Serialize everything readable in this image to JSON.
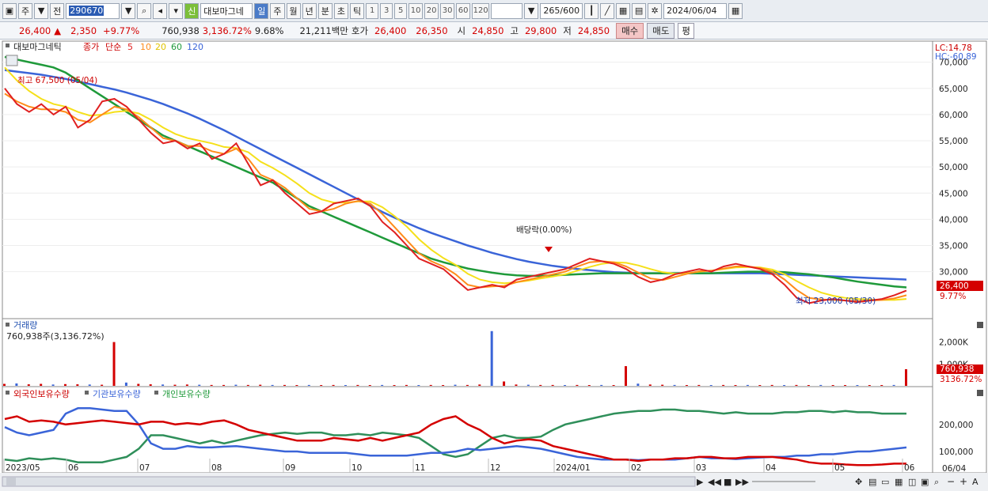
{
  "toolbar": {
    "market": "주",
    "prev_label": "전",
    "code": "290670",
    "new_badge": "신",
    "name": "대보마그네",
    "periods": [
      "일",
      "주",
      "월",
      "년",
      "분",
      "초",
      "틱"
    ],
    "intervals": [
      "1",
      "3",
      "5",
      "10",
      "20",
      "30",
      "60",
      "120"
    ],
    "count": "265/600",
    "date": "2024/06/04"
  },
  "price": {
    "last": "26,400",
    "change": "2,350",
    "change_pct": "+9.77%",
    "volume": "760,938",
    "volume_pct": "3,136.72%",
    "turnover": "9.68%",
    "amount": "21,211백만",
    "ask_label": "호가",
    "ask": "26,400",
    "bid": "26,350",
    "open_label": "시",
    "open": "24,850",
    "high_label": "고",
    "high": "29,800",
    "low_label": "저",
    "low": "24,850",
    "buy_label": "매수",
    "sell_label": "매도",
    "eval_label": "평"
  },
  "chart_data": [
    {
      "type": "line",
      "title": "대보마그네틱",
      "legend": [
        "종가",
        "단순",
        "5",
        "10",
        "20",
        "60",
        "120"
      ],
      "colors": {
        "ma5": "#e02020",
        "ma10": "#ff8c1a",
        "ma20": "#f5e01a",
        "ma60": "#1f9a3a",
        "ma120": "#3a64d8"
      },
      "x_ticks": [
        "2023/05",
        "06",
        "07",
        "08",
        "09",
        "10",
        "11",
        "12",
        "2024/01",
        "02",
        "03",
        "04",
        "05",
        "06"
      ],
      "y_ticks": [
        "70,000",
        "65,000",
        "60,000",
        "55,000",
        "50,000",
        "45,000",
        "40,000",
        "35,000",
        "30,000"
      ],
      "ylim": [
        23000,
        71000
      ],
      "lc": "LC:14.78",
      "hc": "HC:-60.89",
      "annot_high": "최고 67,500 (05/04)",
      "annot_low": "최저 23,000 (05/30)",
      "annot_div": "배당락(0.00%)",
      "last_label": "26,400",
      "last_pct": "9.77%",
      "series": [
        {
          "name": "5",
          "values": [
            65000,
            62000,
            60500,
            62000,
            60000,
            61500,
            57500,
            59000,
            62500,
            63000,
            61500,
            59000,
            56500,
            54500,
            55000,
            53500,
            54500,
            51500,
            52500,
            54500,
            50500,
            46500,
            47500,
            45000,
            43000,
            41000,
            41500,
            43000,
            43500,
            44000,
            42500,
            39500,
            37500,
            35000,
            32500,
            31500,
            30500,
            28500,
            26500,
            27000,
            27500,
            27000,
            28500,
            29000,
            29500,
            30000,
            30500,
            31500,
            32500,
            32000,
            31500,
            30500,
            29000,
            28000,
            28500,
            29500,
            30000,
            30500,
            30000,
            31000,
            31500,
            31000,
            30500,
            29500,
            27500,
            25000,
            24000,
            24500,
            24800,
            24500,
            24200,
            24500,
            24800,
            25500,
            26400
          ]
        },
        {
          "name": "10",
          "values": [
            64000,
            62500,
            61500,
            61000,
            61000,
            60500,
            59000,
            58500,
            60000,
            61500,
            61000,
            59500,
            57500,
            55500,
            55000,
            54000,
            54000,
            53000,
            52500,
            53500,
            51500,
            48500,
            47500,
            46000,
            44000,
            42000,
            41500,
            42000,
            43000,
            43500,
            43000,
            41000,
            38500,
            36000,
            33500,
            32000,
            31000,
            29500,
            27500,
            27000,
            27200,
            27300,
            28000,
            28500,
            29000,
            29500,
            30000,
            31000,
            31800,
            32000,
            31800,
            31000,
            29800,
            28700,
            28400,
            29000,
            29600,
            30100,
            30200,
            30600,
            31000,
            31000,
            30700,
            30000,
            28500,
            26500,
            25000,
            24700,
            24600,
            24500,
            24400,
            24500,
            24600,
            24900,
            25500
          ]
        },
        {
          "name": "20",
          "values": [
            69000,
            66500,
            64500,
            63000,
            62000,
            61500,
            60500,
            59800,
            60000,
            60500,
            60700,
            60200,
            59000,
            57500,
            56300,
            55500,
            55000,
            54500,
            53800,
            53600,
            52800,
            51000,
            49800,
            48400,
            46800,
            45000,
            43800,
            43200,
            43200,
            43400,
            43400,
            42300,
            40600,
            38600,
            36200,
            34200,
            32600,
            31300,
            29600,
            28500,
            28000,
            27800,
            28000,
            28300,
            28700,
            29100,
            29500,
            30200,
            30900,
            31500,
            31800,
            31700,
            31200,
            30500,
            29900,
            29600,
            29700,
            30000,
            30200,
            30500,
            30800,
            30900,
            30800,
            30400,
            29500,
            28200,
            27000,
            26000,
            25400,
            25000,
            24800,
            24700,
            24600,
            24600,
            24800
          ]
        },
        {
          "name": "60",
          "values": [
            71000,
            70500,
            70000,
            69500,
            69000,
            68000,
            66500,
            65000,
            63500,
            62000,
            60500,
            59000,
            57500,
            56000,
            55000,
            54000,
            53000,
            52000,
            51000,
            50000,
            49000,
            48000,
            47000,
            45500,
            44000,
            42500,
            41500,
            40500,
            39500,
            38500,
            37500,
            36500,
            35500,
            34500,
            33500,
            32500,
            31800,
            31200,
            30600,
            30200,
            29800,
            29500,
            29300,
            29200,
            29200,
            29300,
            29400,
            29500,
            29600,
            29700,
            29700,
            29700,
            29700,
            29700,
            29700,
            29700,
            29700,
            29700,
            29700,
            29800,
            29900,
            30000,
            30000,
            30000,
            29900,
            29700,
            29500,
            29200,
            28900,
            28500,
            28100,
            27800,
            27500,
            27200,
            27000
          ]
        },
        {
          "name": "120",
          "values": [
            68500,
            68200,
            67900,
            67600,
            67200,
            66800,
            66300,
            65800,
            65300,
            64800,
            64200,
            63500,
            62800,
            62000,
            61100,
            60200,
            59200,
            58100,
            57000,
            55800,
            54600,
            53400,
            52200,
            51000,
            49800,
            48600,
            47400,
            46200,
            45000,
            43800,
            42600,
            41400,
            40300,
            39300,
            38300,
            37400,
            36600,
            35800,
            35000,
            34300,
            33600,
            33000,
            32400,
            31900,
            31500,
            31100,
            30800,
            30500,
            30300,
            30100,
            29900,
            29800,
            29700,
            29700,
            29700,
            29700,
            29700,
            29700,
            29700,
            29700,
            29700,
            29700,
            29700,
            29600,
            29500,
            29400,
            29300,
            29200,
            29100,
            29000,
            28900,
            28800,
            28700,
            28600,
            28500
          ]
        }
      ]
    },
    {
      "type": "bar",
      "title": "거래량",
      "info": "760,938주(3,136.72%)",
      "y_ticks": [
        "2,000K",
        "1,000K"
      ],
      "ylim": [
        0,
        2600000
      ],
      "last_label": "760,938",
      "last_pct": "3136.72%",
      "values": [
        90000,
        110000,
        70000,
        90000,
        60000,
        80000,
        70000,
        60000,
        50000,
        2000000,
        150000,
        90000,
        70000,
        60000,
        50000,
        60000,
        50000,
        40000,
        40000,
        50000,
        40000,
        50000,
        40000,
        40000,
        35000,
        40000,
        30000,
        40000,
        30000,
        40000,
        30000,
        40000,
        30000,
        40000,
        30000,
        40000,
        30000,
        50000,
        40000,
        60000,
        2500000,
        200000,
        60000,
        50000,
        40000,
        40000,
        30000,
        40000,
        30000,
        40000,
        30000,
        900000,
        100000,
        60000,
        50000,
        40000,
        30000,
        40000,
        30000,
        40000,
        30000,
        40000,
        30000,
        40000,
        30000,
        40000,
        30000,
        40000,
        30000,
        30000,
        30000,
        30000,
        30000,
        40000,
        760938
      ]
    },
    {
      "type": "line",
      "title": "외국인보유수량",
      "legend": [
        "외국인보유수량",
        "기관보유수량",
        "개인보유수량"
      ],
      "y_ticks": [
        "200,000",
        "100,000"
      ],
      "ylim": [
        30000,
        290000
      ],
      "series": [
        {
          "name": "외국인보유수량",
          "values": [
            220000,
            230000,
            210000,
            215000,
            210000,
            200000,
            205000,
            210000,
            215000,
            210000,
            205000,
            200000,
            210000,
            210000,
            200000,
            205000,
            200000,
            210000,
            215000,
            200000,
            180000,
            170000,
            160000,
            150000,
            140000,
            140000,
            140000,
            150000,
            145000,
            140000,
            150000,
            140000,
            150000,
            160000,
            170000,
            200000,
            220000,
            230000,
            200000,
            180000,
            150000,
            130000,
            140000,
            145000,
            140000,
            120000,
            110000,
            100000,
            90000,
            80000,
            70000,
            70000,
            65000,
            70000,
            70000,
            75000,
            75000,
            80000,
            80000,
            75000,
            75000,
            80000,
            80000,
            80000,
            75000,
            70000,
            60000,
            55000,
            55000,
            52000,
            50000,
            50000,
            52000,
            55000,
            55000
          ]
        },
        {
          "name": "기관보유수량",
          "values": [
            190000,
            170000,
            160000,
            170000,
            180000,
            240000,
            260000,
            260000,
            255000,
            250000,
            250000,
            200000,
            130000,
            110000,
            110000,
            120000,
            115000,
            115000,
            118000,
            120000,
            115000,
            110000,
            105000,
            100000,
            100000,
            95000,
            95000,
            95000,
            95000,
            90000,
            85000,
            85000,
            85000,
            85000,
            90000,
            95000,
            95000,
            100000,
            110000,
            105000,
            110000,
            115000,
            120000,
            115000,
            110000,
            100000,
            90000,
            80000,
            75000,
            70000,
            70000,
            70000,
            68000,
            70000,
            70000,
            70000,
            75000,
            80000,
            75000,
            75000,
            72000,
            75000,
            78000,
            80000,
            80000,
            85000,
            85000,
            90000,
            90000,
            95000,
            100000,
            100000,
            105000,
            110000,
            115000
          ]
        },
        {
          "name": "개인보유수량",
          "values": [
            70000,
            65000,
            75000,
            70000,
            75000,
            70000,
            60000,
            60000,
            60000,
            70000,
            80000,
            110000,
            160000,
            160000,
            150000,
            140000,
            130000,
            140000,
            130000,
            140000,
            150000,
            160000,
            165000,
            170000,
            165000,
            170000,
            170000,
            160000,
            160000,
            165000,
            160000,
            170000,
            165000,
            160000,
            150000,
            120000,
            90000,
            80000,
            90000,
            120000,
            150000,
            160000,
            150000,
            150000,
            155000,
            180000,
            200000,
            210000,
            220000,
            230000,
            240000,
            245000,
            250000,
            250000,
            255000,
            255000,
            250000,
            250000,
            245000,
            240000,
            245000,
            240000,
            240000,
            240000,
            245000,
            245000,
            250000,
            250000,
            245000,
            250000,
            245000,
            245000,
            240000,
            240000,
            240000
          ]
        }
      ]
    }
  ],
  "status_bar": {
    "date_tag": "06/04"
  }
}
